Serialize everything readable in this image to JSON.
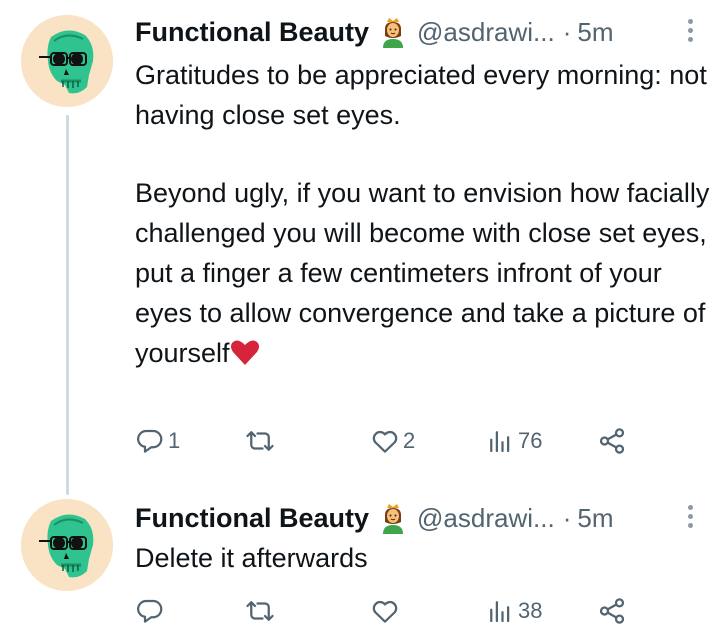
{
  "tweets": [
    {
      "author_name": "Functional Beauty",
      "badge_icon": "person-with-crown-emoji",
      "handle": "@asdrawi...",
      "separator": "·",
      "time": "5m",
      "paragraphs": [
        "Gratitudes to be appreciated every morning: not having close set eyes.",
        "Beyond ugly, if you want to envision how facially challenged you will become with close set eyes, put a finger a few centimeters infront of your eyes to allow convergence and take a picture of yourself"
      ],
      "trailing_emoji": "red-heart",
      "actions": {
        "replies": "1",
        "retweets": "",
        "likes": "2",
        "views": "76"
      }
    },
    {
      "author_name": "Functional Beauty",
      "badge_icon": "person-with-crown-emoji",
      "handle": "@asdrawi...",
      "separator": "·",
      "time": "5m",
      "paragraphs": [
        "Delete it afterwards"
      ],
      "actions": {
        "replies": "",
        "retweets": "",
        "likes": "",
        "views": "38"
      }
    }
  ],
  "colors": {
    "text": "#0f1419",
    "secondary": "#536471",
    "thread_line": "#cfd9de",
    "avatar_bg": "#f9e3c4",
    "skull": "#2fc48f",
    "heart": "#d6243a"
  }
}
